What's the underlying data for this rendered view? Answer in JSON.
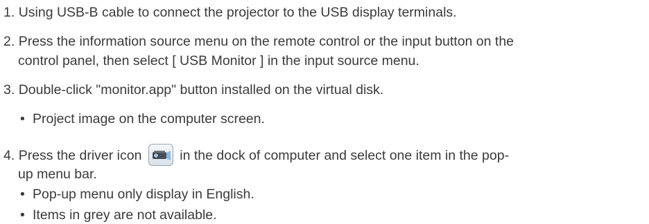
{
  "steps": [
    {
      "number": "1.",
      "text": "Using USB-B cable to connect the projector to the USB display terminals."
    },
    {
      "number": "2.",
      "line1": "Press the information source menu on the remote control or the input button on the",
      "line2": "control panel, then select [ USB Monitor ] in the input source menu."
    },
    {
      "number": "3.",
      "text": "Double-click \"monitor.app\" button installed on the virtual disk.",
      "bullets": [
        "Project image on the computer screen."
      ]
    },
    {
      "number": "4.",
      "before_icon": "Press the driver icon",
      "after_icon": "in the dock of computer and select one item in the pop-",
      "line2": "up menu bar.",
      "icon": "projector-driver-icon",
      "bullets": [
        "Pop-up menu only display in English.",
        "Items in grey are not available."
      ]
    }
  ],
  "bullet_glyph": "•"
}
